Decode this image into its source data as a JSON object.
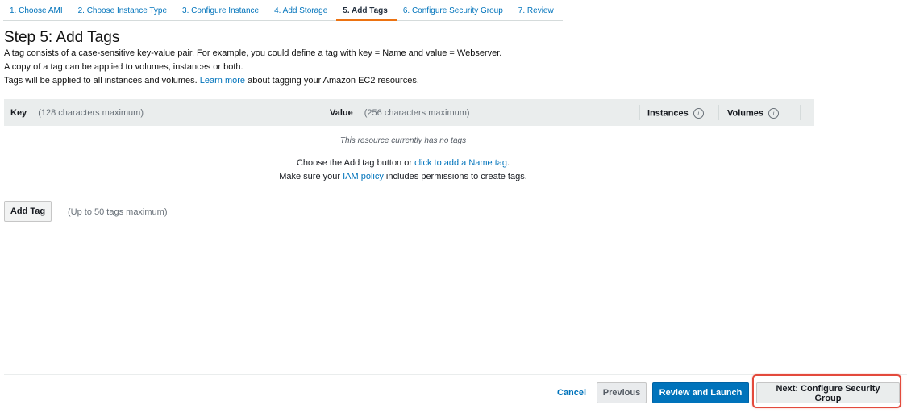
{
  "wizard": {
    "steps": [
      {
        "label": "1. Choose AMI"
      },
      {
        "label": "2. Choose Instance Type"
      },
      {
        "label": "3. Configure Instance"
      },
      {
        "label": "4. Add Storage"
      },
      {
        "label": "5. Add Tags"
      },
      {
        "label": "6. Configure Security Group"
      },
      {
        "label": "7. Review"
      }
    ],
    "active_step": "5. Add Tags"
  },
  "page": {
    "title": "Step 5: Add Tags",
    "desc_line1": "A tag consists of a case-sensitive key-value pair. For example, you could define a tag with key = Name and value = Webserver.",
    "desc_line2": "A copy of a tag can be applied to volumes, instances or both.",
    "desc_line3_before": "Tags will be applied to all instances and volumes.",
    "desc_line3_link": "Learn more",
    "desc_line3_after": "about tagging your Amazon EC2 resources."
  },
  "table": {
    "key_header": "Key",
    "key_hint": "(128 characters maximum)",
    "value_header": "Value",
    "value_hint": "(256 characters maximum)",
    "instances_header": "Instances",
    "volumes_header": "Volumes",
    "info_glyph": "i",
    "empty_message": "This resource currently has no tags",
    "help1_before": "Choose the Add tag button or",
    "help1_link": "click to add a Name tag",
    "help1_after": ".",
    "help2_before": "Make sure your",
    "help2_link": "IAM policy",
    "help2_after": "includes permissions to create tags."
  },
  "add_tag": {
    "button_label": "Add Tag",
    "hint": "(Up to 50 tags maximum)"
  },
  "footer": {
    "cancel_label": "Cancel",
    "previous_label": "Previous",
    "review_label": "Review and Launch",
    "next_label": "Next: Configure Security Group"
  },
  "colors": {
    "link": "#0073bb",
    "primary_button": "#0073bb",
    "active_tab_underline": "#ec7211",
    "highlight_border": "#e34a3c"
  }
}
